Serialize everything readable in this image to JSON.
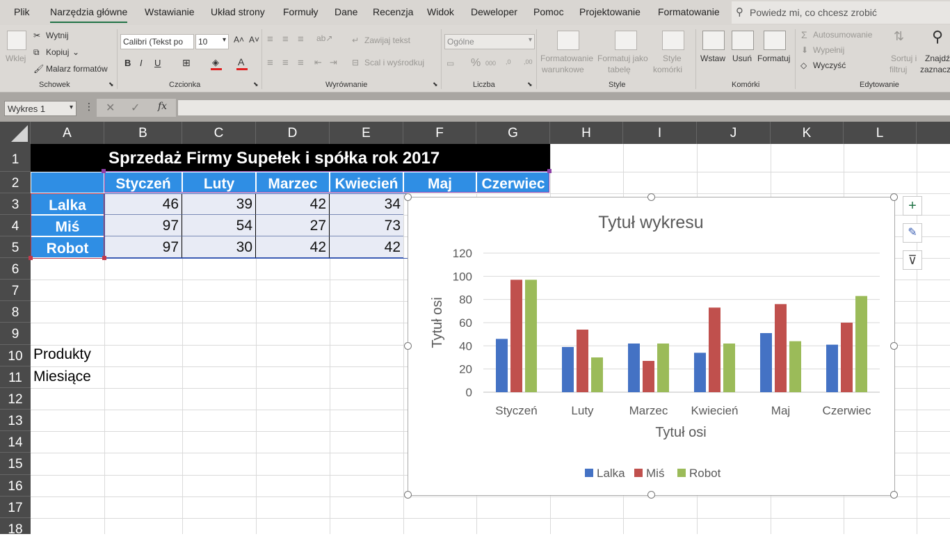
{
  "menu": {
    "tabs": [
      "Plik",
      "Narzędzia główne",
      "Wstawianie",
      "Układ strony",
      "Formuły",
      "Dane",
      "Recenzja",
      "Widok",
      "Deweloper",
      "Pomoc",
      "Projektowanie",
      "Formatowanie"
    ],
    "active_tab": "Narzędzia główne",
    "tell_me": "Powiedz mi, co chcesz zrobić"
  },
  "ribbon": {
    "clipboard": {
      "paste": "Wklej",
      "cut": "Wytnij",
      "copy": "Kopiuj",
      "painter": "Malarz formatów",
      "label": "Schowek"
    },
    "font": {
      "name": "Calibri (Tekst po",
      "size": "10",
      "label": "Czcionka",
      "bold": "B",
      "italic": "I",
      "underline": "U"
    },
    "alignment": {
      "wrap": "Zawijaj tekst",
      "merge": "Scal i wyśrodkuj",
      "label": "Wyrównanie"
    },
    "number": {
      "format": "Ogólne",
      "label": "Liczba"
    },
    "styles": {
      "cond_1": "Formatowanie",
      "cond_2": "warunkowe",
      "table_1": "Formatuj jako",
      "table_2": "tabelę",
      "cell_1": "Style",
      "cell_2": "komórki",
      "label": "Style"
    },
    "cells": {
      "insert": "Wstaw",
      "delete": "Usuń",
      "format": "Formatuj",
      "label": "Komórki"
    },
    "editing": {
      "autosum": "Autosumowanie",
      "fill": "Wypełnij",
      "clear": "Wyczyść",
      "sort_1": "Sortuj i",
      "sort_2": "filtruj",
      "find_1": "Znajdź i",
      "find_2": "zaznacz",
      "label": "Edytowanie"
    }
  },
  "formula_bar": {
    "name_box": "Wykres 1",
    "fx": "fx"
  },
  "columns": [
    "A",
    "B",
    "C",
    "D",
    "E",
    "F",
    "G",
    "H",
    "I",
    "J",
    "K",
    "L"
  ],
  "rows": [
    "1",
    "2",
    "3",
    "4",
    "5",
    "6",
    "7",
    "8",
    "9",
    "10",
    "11",
    "12",
    "13",
    "14",
    "15",
    "16",
    "17",
    "18"
  ],
  "sheet": {
    "title": "Sprzedaż Firmy Supełek i spółka rok 2017",
    "months": [
      "Styczeń",
      "Luty",
      "Marzec",
      "Kwiecień",
      "Maj",
      "Czerwiec"
    ],
    "rows": [
      {
        "product": "Lalka",
        "visible_values": [
          "46",
          "39",
          "42",
          "34"
        ]
      },
      {
        "product": "Miś",
        "visible_values": [
          "97",
          "54",
          "27",
          "73"
        ]
      },
      {
        "product": "Robot",
        "visible_values": [
          "97",
          "30",
          "42",
          "42"
        ]
      }
    ],
    "a10": "Produkty",
    "a11": "Miesiące"
  },
  "chart_data": {
    "type": "bar",
    "title": "Tytuł wykresu",
    "xlabel": "Tytuł osi",
    "ylabel": "Tytuł osi",
    "categories": [
      "Styczeń",
      "Luty",
      "Marzec",
      "Kwiecień",
      "Maj",
      "Czerwiec"
    ],
    "series": [
      {
        "name": "Lalka",
        "values": [
          46,
          39,
          42,
          34,
          51,
          41
        ],
        "color": "#4472c4"
      },
      {
        "name": "Miś",
        "values": [
          97,
          54,
          27,
          73,
          76,
          60
        ],
        "color": "#c0504d"
      },
      {
        "name": "Robot",
        "values": [
          97,
          30,
          42,
          42,
          44,
          83
        ],
        "color": "#9bbb59"
      }
    ],
    "ylim": [
      0,
      120
    ],
    "yticks": [
      "0",
      "20",
      "40",
      "60",
      "80",
      "100",
      "120"
    ],
    "grid": true,
    "legend": "bottom"
  },
  "chart_buttons": {
    "add": "+",
    "style": "✎",
    "filter": "⊽"
  }
}
